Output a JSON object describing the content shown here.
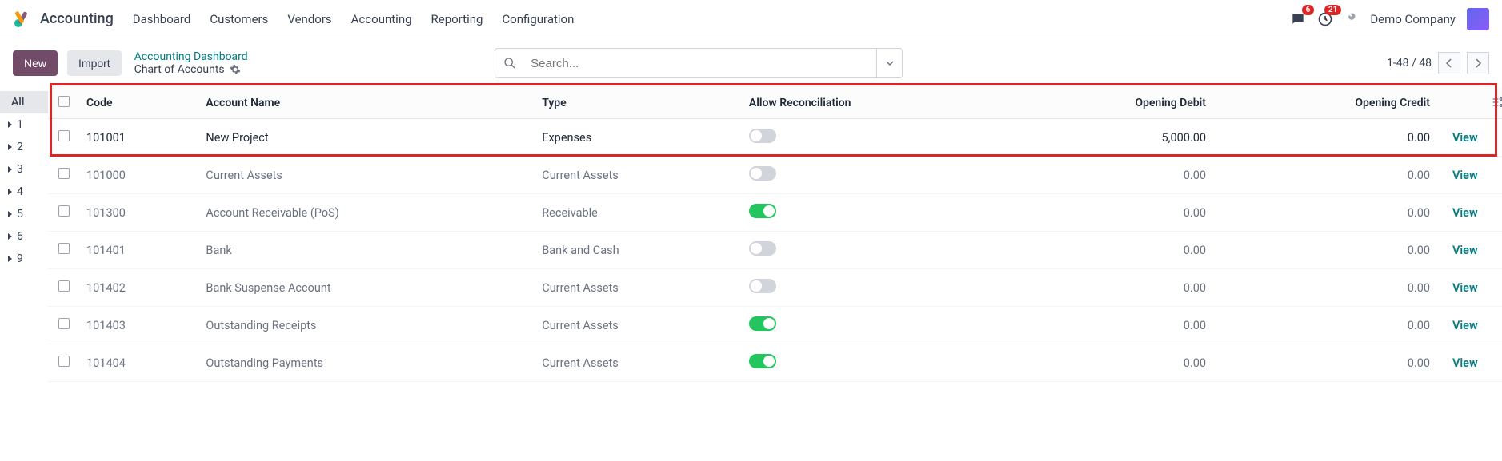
{
  "app": {
    "title": "Accounting"
  },
  "nav": {
    "items": [
      "Dashboard",
      "Customers",
      "Vendors",
      "Accounting",
      "Reporting",
      "Configuration"
    ]
  },
  "topRight": {
    "messagesBadge": "6",
    "activitiesBadge": "21",
    "company": "Demo Company"
  },
  "controls": {
    "newLabel": "New",
    "importLabel": "Import",
    "breadcrumbParent": "Accounting Dashboard",
    "breadcrumbCurrent": "Chart of Accounts",
    "searchPlaceholder": "Search...",
    "pager": "1-48 / 48"
  },
  "sidebar": {
    "all": "All",
    "items": [
      "1",
      "2",
      "3",
      "4",
      "5",
      "6",
      "9"
    ]
  },
  "table": {
    "headers": {
      "code": "Code",
      "name": "Account Name",
      "type": "Type",
      "reconcile": "Allow Reconciliation",
      "debit": "Opening Debit",
      "credit": "Opening Credit"
    },
    "viewLabel": "View",
    "rows": [
      {
        "code": "101001",
        "name": "New Project",
        "type": "Expenses",
        "reconcile": false,
        "debit": "5,000.00",
        "credit": "0.00",
        "highlighted": true
      },
      {
        "code": "101000",
        "name": "Current Assets",
        "type": "Current Assets",
        "reconcile": false,
        "debit": "0.00",
        "credit": "0.00"
      },
      {
        "code": "101300",
        "name": "Account Receivable (PoS)",
        "type": "Receivable",
        "reconcile": true,
        "debit": "0.00",
        "credit": "0.00"
      },
      {
        "code": "101401",
        "name": "Bank",
        "type": "Bank and Cash",
        "reconcile": false,
        "debit": "0.00",
        "credit": "0.00"
      },
      {
        "code": "101402",
        "name": "Bank Suspense Account",
        "type": "Current Assets",
        "reconcile": false,
        "debit": "0.00",
        "credit": "0.00"
      },
      {
        "code": "101403",
        "name": "Outstanding Receipts",
        "type": "Current Assets",
        "reconcile": true,
        "debit": "0.00",
        "credit": "0.00"
      },
      {
        "code": "101404",
        "name": "Outstanding Payments",
        "type": "Current Assets",
        "reconcile": true,
        "debit": "0.00",
        "credit": "0.00"
      }
    ]
  }
}
